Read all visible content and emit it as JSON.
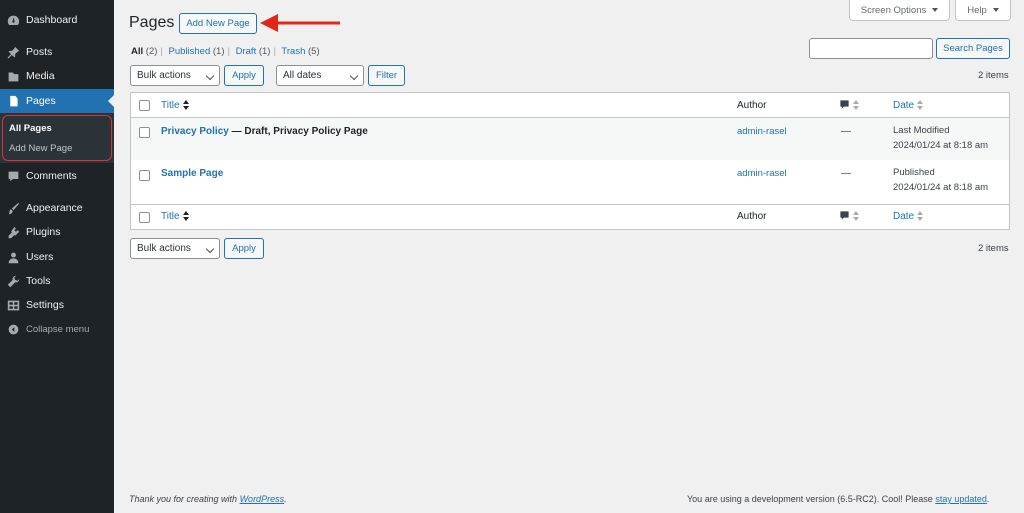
{
  "sidebar": {
    "items": [
      {
        "label": "Dashboard",
        "icon": "dashboard-icon"
      },
      {
        "label": "Posts",
        "icon": "pin-icon"
      },
      {
        "label": "Media",
        "icon": "media-icon"
      },
      {
        "label": "Pages",
        "icon": "page-icon"
      },
      {
        "label": "Comments",
        "icon": "comment-icon"
      },
      {
        "label": "Appearance",
        "icon": "brush-icon"
      },
      {
        "label": "Plugins",
        "icon": "plugin-icon"
      },
      {
        "label": "Users",
        "icon": "user-icon"
      },
      {
        "label": "Tools",
        "icon": "wrench-icon"
      },
      {
        "label": "Settings",
        "icon": "settings-icon"
      }
    ],
    "submenu": [
      "All Pages",
      "Add New Page"
    ],
    "collapse_label": "Collapse menu",
    "accent_color": "#2271b1",
    "highlight_color": "#d63638"
  },
  "header": {
    "title": "Pages",
    "add_new_label": "Add New Page",
    "screen_options_label": "Screen Options",
    "help_label": "Help"
  },
  "filters": {
    "all_label": "All",
    "all_count": "(2)",
    "published_label": "Published",
    "published_count": "(1)",
    "draft_label": "Draft",
    "draft_count": "(1)",
    "trash_label": "Trash",
    "trash_count": "(5)"
  },
  "search": {
    "value": "",
    "button_label": "Search Pages"
  },
  "tablenav": {
    "bulk_actions": "Bulk actions",
    "apply_label": "Apply",
    "dates": "All dates",
    "filter_label": "Filter",
    "items_count": "2 items"
  },
  "table": {
    "columns": {
      "title": "Title",
      "author": "Author",
      "date": "Date"
    },
    "rows": [
      {
        "title": "Privacy Policy",
        "state": " — Draft, Privacy Policy Page",
        "author": "admin-rasel",
        "comments": "—",
        "date_status": "Last Modified",
        "date": "2024/01/24 at 8:18 am"
      },
      {
        "title": "Sample Page",
        "state": "",
        "author": "admin-rasel",
        "comments": "—",
        "date_status": "Published",
        "date": "2024/01/24 at 8:18 am"
      }
    ]
  },
  "footer": {
    "thanks_prefix": "Thank you for creating with ",
    "thanks_link": "WordPress",
    "thanks_suffix": ".",
    "version_text": "You are using a development version (6.5-RC2). Cool! Please ",
    "version_link": "stay updated",
    "version_suffix": "."
  }
}
